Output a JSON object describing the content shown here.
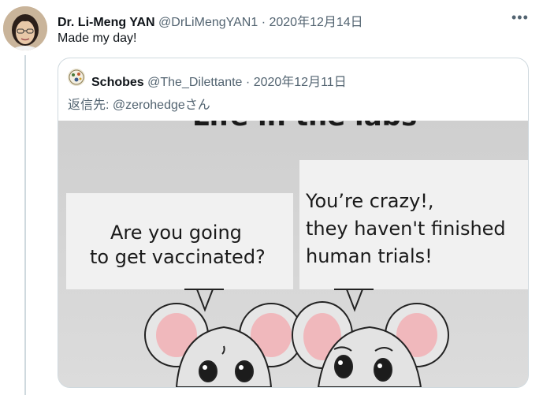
{
  "tweet": {
    "author_name": "Dr. Li-Meng YAN",
    "author_handle": "@DrLiMengYAN1",
    "separator": "·",
    "date": "2020年12月14日",
    "text": "Made my day!",
    "more_icon": "more-horizontal-icon"
  },
  "quote": {
    "author_name": "Schobes",
    "author_handle": "@The_Dilettante",
    "separator": "·",
    "date": "2020年12月11日",
    "reply_prefix": "返信先: ",
    "reply_mention": "@zerohedge",
    "reply_suffix": "さん",
    "media": {
      "top_caption_fragment": "Life in the labs",
      "left_bubble_line1": "Are you going",
      "left_bubble_line2": "to get vaccinated?",
      "right_bubble_line1": "You’re crazy!,",
      "right_bubble_line2": "they haven't finished",
      "right_bubble_line3": "human trials!"
    }
  }
}
